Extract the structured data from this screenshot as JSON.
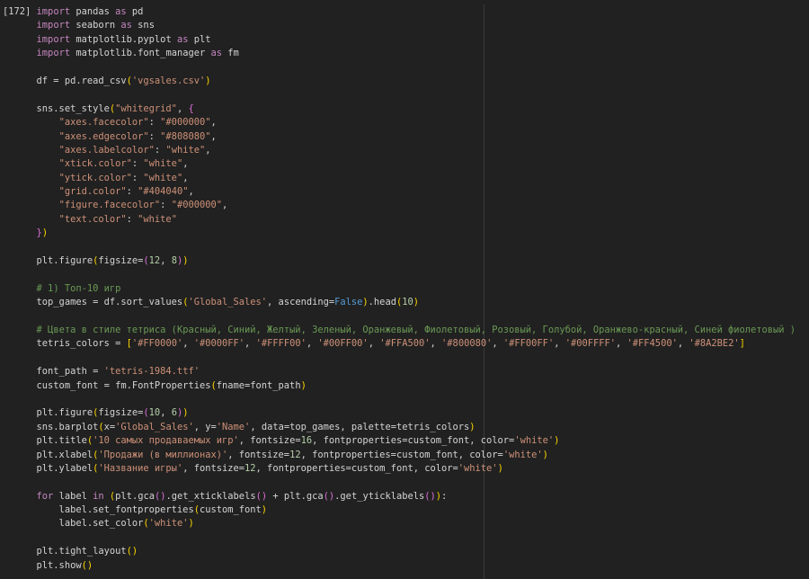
{
  "editor": {
    "background": "#212121",
    "ruler_color": "#3a3a3a",
    "execution_count": "[172]",
    "palette": {
      "x": "#d4d4d4",
      "p": "#d4d4d4",
      "k": "#c586c0",
      "s": "#ce9178",
      "c": "#6a9955",
      "n": "#b5cea8",
      "b": "#569cd6",
      "g1": "#ffd700",
      "g2": "#da70d6"
    },
    "lines": [
      [
        {
          "c": "x",
          "t": "[172] ",
          "n": "execution-count",
          "i": true
        },
        {
          "c": "k",
          "t": "import"
        },
        {
          "c": "p",
          "t": " pandas "
        },
        {
          "c": "k",
          "t": "as"
        },
        {
          "c": "p",
          "t": " pd"
        }
      ],
      [
        {
          "c": "p",
          "t": "      "
        },
        {
          "c": "k",
          "t": "import"
        },
        {
          "c": "p",
          "t": " seaborn "
        },
        {
          "c": "k",
          "t": "as"
        },
        {
          "c": "p",
          "t": " sns"
        }
      ],
      [
        {
          "c": "p",
          "t": "      "
        },
        {
          "c": "k",
          "t": "import"
        },
        {
          "c": "p",
          "t": " matplotlib.pyplot "
        },
        {
          "c": "k",
          "t": "as"
        },
        {
          "c": "p",
          "t": " plt"
        }
      ],
      [
        {
          "c": "p",
          "t": "      "
        },
        {
          "c": "k",
          "t": "import"
        },
        {
          "c": "p",
          "t": " matplotlib.font_manager "
        },
        {
          "c": "k",
          "t": "as"
        },
        {
          "c": "p",
          "t": " fm"
        }
      ],
      [],
      [
        {
          "c": "p",
          "t": "      df = pd.read_csv"
        },
        {
          "c": "g1",
          "t": "("
        },
        {
          "c": "s",
          "t": "'vgsales.csv'"
        },
        {
          "c": "g1",
          "t": ")"
        }
      ],
      [],
      [
        {
          "c": "p",
          "t": "      sns.set_style"
        },
        {
          "c": "g1",
          "t": "("
        },
        {
          "c": "s",
          "t": "\"whitegrid\""
        },
        {
          "c": "p",
          "t": ", "
        },
        {
          "c": "g2",
          "t": "{"
        }
      ],
      [
        {
          "c": "p",
          "t": "          "
        },
        {
          "c": "s",
          "t": "\"axes.facecolor\""
        },
        {
          "c": "p",
          "t": ": "
        },
        {
          "c": "s",
          "t": "\"#000000\""
        },
        {
          "c": "p",
          "t": ","
        }
      ],
      [
        {
          "c": "p",
          "t": "          "
        },
        {
          "c": "s",
          "t": "\"axes.edgecolor\""
        },
        {
          "c": "p",
          "t": ": "
        },
        {
          "c": "s",
          "t": "\"#808080\""
        },
        {
          "c": "p",
          "t": ","
        }
      ],
      [
        {
          "c": "p",
          "t": "          "
        },
        {
          "c": "s",
          "t": "\"axes.labelcolor\""
        },
        {
          "c": "p",
          "t": ": "
        },
        {
          "c": "s",
          "t": "\"white\""
        },
        {
          "c": "p",
          "t": ","
        }
      ],
      [
        {
          "c": "p",
          "t": "          "
        },
        {
          "c": "s",
          "t": "\"xtick.color\""
        },
        {
          "c": "p",
          "t": ": "
        },
        {
          "c": "s",
          "t": "\"white\""
        },
        {
          "c": "p",
          "t": ","
        }
      ],
      [
        {
          "c": "p",
          "t": "          "
        },
        {
          "c": "s",
          "t": "\"ytick.color\""
        },
        {
          "c": "p",
          "t": ": "
        },
        {
          "c": "s",
          "t": "\"white\""
        },
        {
          "c": "p",
          "t": ","
        }
      ],
      [
        {
          "c": "p",
          "t": "          "
        },
        {
          "c": "s",
          "t": "\"grid.color\""
        },
        {
          "c": "p",
          "t": ": "
        },
        {
          "c": "s",
          "t": "\"#404040\""
        },
        {
          "c": "p",
          "t": ","
        }
      ],
      [
        {
          "c": "p",
          "t": "          "
        },
        {
          "c": "s",
          "t": "\"figure.facecolor\""
        },
        {
          "c": "p",
          "t": ": "
        },
        {
          "c": "s",
          "t": "\"#000000\""
        },
        {
          "c": "p",
          "t": ","
        }
      ],
      [
        {
          "c": "p",
          "t": "          "
        },
        {
          "c": "s",
          "t": "\"text.color\""
        },
        {
          "c": "p",
          "t": ": "
        },
        {
          "c": "s",
          "t": "\"white\""
        }
      ],
      [
        {
          "c": "p",
          "t": "      "
        },
        {
          "c": "g2",
          "t": "}"
        },
        {
          "c": "g1",
          "t": ")"
        }
      ],
      [],
      [
        {
          "c": "p",
          "t": "      plt.figure"
        },
        {
          "c": "g1",
          "t": "("
        },
        {
          "c": "p",
          "t": "figsize="
        },
        {
          "c": "g2",
          "t": "("
        },
        {
          "c": "n",
          "t": "12"
        },
        {
          "c": "p",
          "t": ", "
        },
        {
          "c": "n",
          "t": "8"
        },
        {
          "c": "g2",
          "t": ")"
        },
        {
          "c": "g1",
          "t": ")"
        }
      ],
      [],
      [
        {
          "c": "p",
          "t": "      "
        },
        {
          "c": "c",
          "t": "# 1) Топ-10 игр"
        }
      ],
      [
        {
          "c": "p",
          "t": "      top_games = df.sort_values"
        },
        {
          "c": "g1",
          "t": "("
        },
        {
          "c": "s",
          "t": "'Global_Sales'"
        },
        {
          "c": "p",
          "t": ", ascending="
        },
        {
          "c": "b",
          "t": "False"
        },
        {
          "c": "g1",
          "t": ")"
        },
        {
          "c": "p",
          "t": ".head"
        },
        {
          "c": "g1",
          "t": "("
        },
        {
          "c": "n",
          "t": "10"
        },
        {
          "c": "g1",
          "t": ")"
        }
      ],
      [],
      [
        {
          "c": "p",
          "t": "      "
        },
        {
          "c": "c",
          "t": "# Цвета в стиле тетриса (Красный, Синий, Желтый, Зеленый, Оранжевый, Фиолетовый, Розовый, Голубой, Оранжево-красный, Синей фиолетовый )"
        }
      ],
      [
        {
          "c": "p",
          "t": "      tetris_colors = "
        },
        {
          "c": "g1",
          "t": "["
        },
        {
          "c": "s",
          "t": "'#FF0000'"
        },
        {
          "c": "p",
          "t": ", "
        },
        {
          "c": "s",
          "t": "'#0000FF'"
        },
        {
          "c": "p",
          "t": ", "
        },
        {
          "c": "s",
          "t": "'#FFFF00'"
        },
        {
          "c": "p",
          "t": ", "
        },
        {
          "c": "s",
          "t": "'#00FF00'"
        },
        {
          "c": "p",
          "t": ", "
        },
        {
          "c": "s",
          "t": "'#FFA500'"
        },
        {
          "c": "p",
          "t": ", "
        },
        {
          "c": "s",
          "t": "'#800080'"
        },
        {
          "c": "p",
          "t": ", "
        },
        {
          "c": "s",
          "t": "'#FF00FF'"
        },
        {
          "c": "p",
          "t": ", "
        },
        {
          "c": "s",
          "t": "'#00FFFF'"
        },
        {
          "c": "p",
          "t": ", "
        },
        {
          "c": "s",
          "t": "'#FF4500'"
        },
        {
          "c": "p",
          "t": ", "
        },
        {
          "c": "s",
          "t": "'#8A2BE2'"
        },
        {
          "c": "g1",
          "t": "]"
        }
      ],
      [],
      [
        {
          "c": "p",
          "t": "      font_path = "
        },
        {
          "c": "s",
          "t": "'tetris-1984.ttf'"
        }
      ],
      [
        {
          "c": "p",
          "t": "      custom_font = fm.FontProperties"
        },
        {
          "c": "g1",
          "t": "("
        },
        {
          "c": "p",
          "t": "fname=font_path"
        },
        {
          "c": "g1",
          "t": ")"
        }
      ],
      [],
      [
        {
          "c": "p",
          "t": "      plt.figure"
        },
        {
          "c": "g1",
          "t": "("
        },
        {
          "c": "p",
          "t": "figsize="
        },
        {
          "c": "g2",
          "t": "("
        },
        {
          "c": "n",
          "t": "10"
        },
        {
          "c": "p",
          "t": ", "
        },
        {
          "c": "n",
          "t": "6"
        },
        {
          "c": "g2",
          "t": ")"
        },
        {
          "c": "g1",
          "t": ")"
        }
      ],
      [
        {
          "c": "p",
          "t": "      sns.barplot"
        },
        {
          "c": "g1",
          "t": "("
        },
        {
          "c": "p",
          "t": "x="
        },
        {
          "c": "s",
          "t": "'Global_Sales'"
        },
        {
          "c": "p",
          "t": ", y="
        },
        {
          "c": "s",
          "t": "'Name'"
        },
        {
          "c": "p",
          "t": ", data=top_games, palette=tetris_colors"
        },
        {
          "c": "g1",
          "t": ")"
        }
      ],
      [
        {
          "c": "p",
          "t": "      plt.title"
        },
        {
          "c": "g1",
          "t": "("
        },
        {
          "c": "s",
          "t": "'10 самых продаваемых игр'"
        },
        {
          "c": "p",
          "t": ", fontsize="
        },
        {
          "c": "n",
          "t": "16"
        },
        {
          "c": "p",
          "t": ", fontproperties=custom_font, color="
        },
        {
          "c": "s",
          "t": "'white'"
        },
        {
          "c": "g1",
          "t": ")"
        }
      ],
      [
        {
          "c": "p",
          "t": "      plt.xlabel"
        },
        {
          "c": "g1",
          "t": "("
        },
        {
          "c": "s",
          "t": "'Продажи (в миллионах)'"
        },
        {
          "c": "p",
          "t": ", fontsize="
        },
        {
          "c": "n",
          "t": "12"
        },
        {
          "c": "p",
          "t": ", fontproperties=custom_font, color="
        },
        {
          "c": "s",
          "t": "'white'"
        },
        {
          "c": "g1",
          "t": ")"
        }
      ],
      [
        {
          "c": "p",
          "t": "      plt.ylabel"
        },
        {
          "c": "g1",
          "t": "("
        },
        {
          "c": "s",
          "t": "'Название игры'"
        },
        {
          "c": "p",
          "t": ", fontsize="
        },
        {
          "c": "n",
          "t": "12"
        },
        {
          "c": "p",
          "t": ", fontproperties=custom_font, color="
        },
        {
          "c": "s",
          "t": "'white'"
        },
        {
          "c": "g1",
          "t": ")"
        }
      ],
      [],
      [
        {
          "c": "p",
          "t": "      "
        },
        {
          "c": "k",
          "t": "for"
        },
        {
          "c": "p",
          "t": " label "
        },
        {
          "c": "k",
          "t": "in"
        },
        {
          "c": "p",
          "t": " "
        },
        {
          "c": "g1",
          "t": "("
        },
        {
          "c": "p",
          "t": "plt.gca"
        },
        {
          "c": "g2",
          "t": "()"
        },
        {
          "c": "p",
          "t": ".get_xticklabels"
        },
        {
          "c": "g2",
          "t": "()"
        },
        {
          "c": "p",
          "t": " + plt.gca"
        },
        {
          "c": "g2",
          "t": "()"
        },
        {
          "c": "p",
          "t": ".get_yticklabels"
        },
        {
          "c": "g2",
          "t": "()"
        },
        {
          "c": "g1",
          "t": ")"
        },
        {
          "c": "p",
          "t": ":"
        }
      ],
      [
        {
          "c": "p",
          "t": "          label.set_fontproperties"
        },
        {
          "c": "g1",
          "t": "("
        },
        {
          "c": "p",
          "t": "custom_font"
        },
        {
          "c": "g1",
          "t": ")"
        }
      ],
      [
        {
          "c": "p",
          "t": "          label.set_color"
        },
        {
          "c": "g1",
          "t": "("
        },
        {
          "c": "s",
          "t": "'white'"
        },
        {
          "c": "g1",
          "t": ")"
        }
      ],
      [],
      [
        {
          "c": "p",
          "t": "      plt.tight_layout"
        },
        {
          "c": "g1",
          "t": "("
        },
        {
          "c": "g1",
          "t": ")"
        }
      ],
      [
        {
          "c": "p",
          "t": "      plt.show"
        },
        {
          "c": "g1",
          "t": "("
        },
        {
          "c": "g1",
          "t": ")"
        }
      ]
    ]
  }
}
